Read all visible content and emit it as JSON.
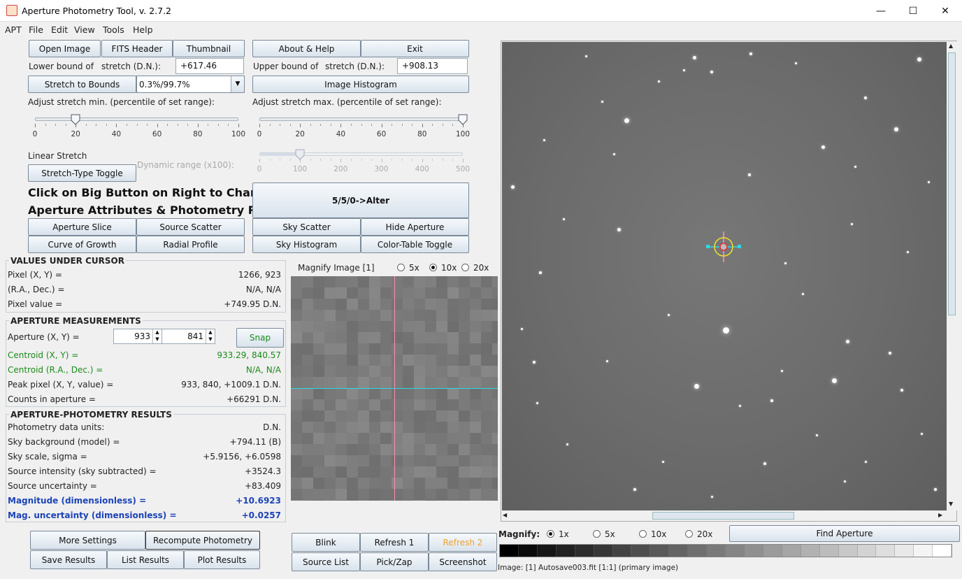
{
  "window": {
    "title": "Aperture Photometry Tool, v. 2.7.2",
    "minimize": "—",
    "maximize": "☐",
    "close": "✕"
  },
  "menu": [
    "APT",
    "File",
    "Edit",
    "View",
    "Tools",
    "Help"
  ],
  "toolbar": {
    "open_image": "Open Image",
    "fits_header": "FITS Header",
    "thumbnail": "Thumbnail",
    "about_help": "About & Help",
    "exit": "Exit"
  },
  "stretch": {
    "lower_label": "Lower bound of",
    "lower_label2": "stretch (D.N.):",
    "lower_value": "+617.46",
    "upper_label": "Upper bound of",
    "upper_label2": "stretch (D.N.):",
    "upper_value": "+908.13",
    "stretch_to_bounds": "Stretch to Bounds",
    "range_select": "0.3%/99.7%",
    "image_histogram": "Image Histogram",
    "adjust_min_label": "Adjust stretch min. (percentile of set range):",
    "adjust_max_label": "Adjust stretch max. (percentile of set range):",
    "min_ticks": [
      "0",
      "20",
      "40",
      "60",
      "80",
      "100"
    ],
    "max_ticks": [
      "0",
      "20",
      "40",
      "60",
      "80",
      "100"
    ],
    "min_slider_value": 20,
    "max_slider_value": 100,
    "linear_stretch": "Linear Stretch",
    "stretch_type_toggle": "Stretch-Type Toggle",
    "dynamic_range_label": "Dynamic range (x100):",
    "dyn_ticks": [
      "0",
      "100",
      "200",
      "300",
      "400",
      "500"
    ],
    "dyn_slider_value": 100
  },
  "aperture": {
    "instruction_line1": "Click on Big Button on Right to Change",
    "instruction_line2": "Aperture Attributes & Photometry Radii:",
    "alter_button": "5/5/0->Alter",
    "aperture_slice": "Aperture Slice",
    "source_scatter": "Source Scatter",
    "sky_scatter": "Sky Scatter",
    "hide_aperture": "Hide Aperture",
    "curve_of_growth": "Curve of Growth",
    "radial_profile": "Radial Profile",
    "sky_histogram": "Sky Histogram",
    "color_table_toggle": "Color-Table Toggle"
  },
  "values_under_cursor": {
    "title": "VALUES UNDER CURSOR",
    "rows": [
      {
        "k": "Pixel (X, Y) =",
        "v": "1266, 923"
      },
      {
        "k": "(R.A., Dec.) =",
        "v": "N/A, N/A"
      },
      {
        "k": "Pixel value =",
        "v": "+749.95 D.N."
      }
    ]
  },
  "aperture_measurements": {
    "title": "APERTURE MEASUREMENTS",
    "aperture_xy_label": "Aperture (X, Y) =",
    "x": "933",
    "y": "841",
    "snap": "Snap",
    "centroid_xy_label": "Centroid (X, Y) =",
    "centroid_xy": "933.29, 840.57",
    "centroid_radec_label": "Centroid (R.A., Dec.) =",
    "centroid_radec": "N/A, N/A",
    "peak_label": "Peak pixel (X, Y, value) =",
    "peak": "933, 840, +1009.1 D.N.",
    "counts_label": "Counts in aperture =",
    "counts": "+66291 D.N."
  },
  "photometry_results": {
    "title": "APERTURE-PHOTOMETRY RESULTS",
    "rows": [
      {
        "k": "Photometry data units:",
        "v": "D.N."
      },
      {
        "k": "Sky background (model) =",
        "v": "+794.11 (B)"
      },
      {
        "k": "Sky scale, sigma =",
        "v": "+5.9156, +6.0598"
      },
      {
        "k": "Source intensity (sky subtracted)  =",
        "v": "+3524.3"
      },
      {
        "k": "Source uncertainty =",
        "v": "+83.409"
      }
    ],
    "magnitude_label": "Magnitude (dimensionless) =",
    "magnitude": "+10.6923",
    "mag_unc_label": "Mag. uncertainty (dimensionless) =",
    "mag_unc": "+0.0257"
  },
  "magnify": {
    "label": "Magnify Image [1]",
    "options": [
      "5x",
      "10x",
      "20x"
    ],
    "selected": "10x"
  },
  "bottom_left": {
    "more_settings": "More Settings",
    "recompute": "Recompute Photometry",
    "save_results": "Save Results",
    "list_results": "List Results",
    "plot_results": "Plot Results"
  },
  "bottom_mid": {
    "blink": "Blink",
    "refresh1": "Refresh 1",
    "refresh2": "Refresh 2",
    "source_list": "Source List",
    "pick_zap": "Pick/Zap",
    "screenshot": "Screenshot"
  },
  "image_view": {
    "magnify_label": "Magnify:",
    "magnify_options": [
      "1x",
      "5x",
      "10x",
      "20x"
    ],
    "magnify_selected": "1x",
    "find_aperture": "Find Aperture",
    "status": "Image: [1]  Autosave003.fit [1:1] (primary image)"
  },
  "colors": {
    "accent_orange": "#f0a030",
    "green_text": "#1a8a1a",
    "blue_text": "#1c44b8"
  }
}
